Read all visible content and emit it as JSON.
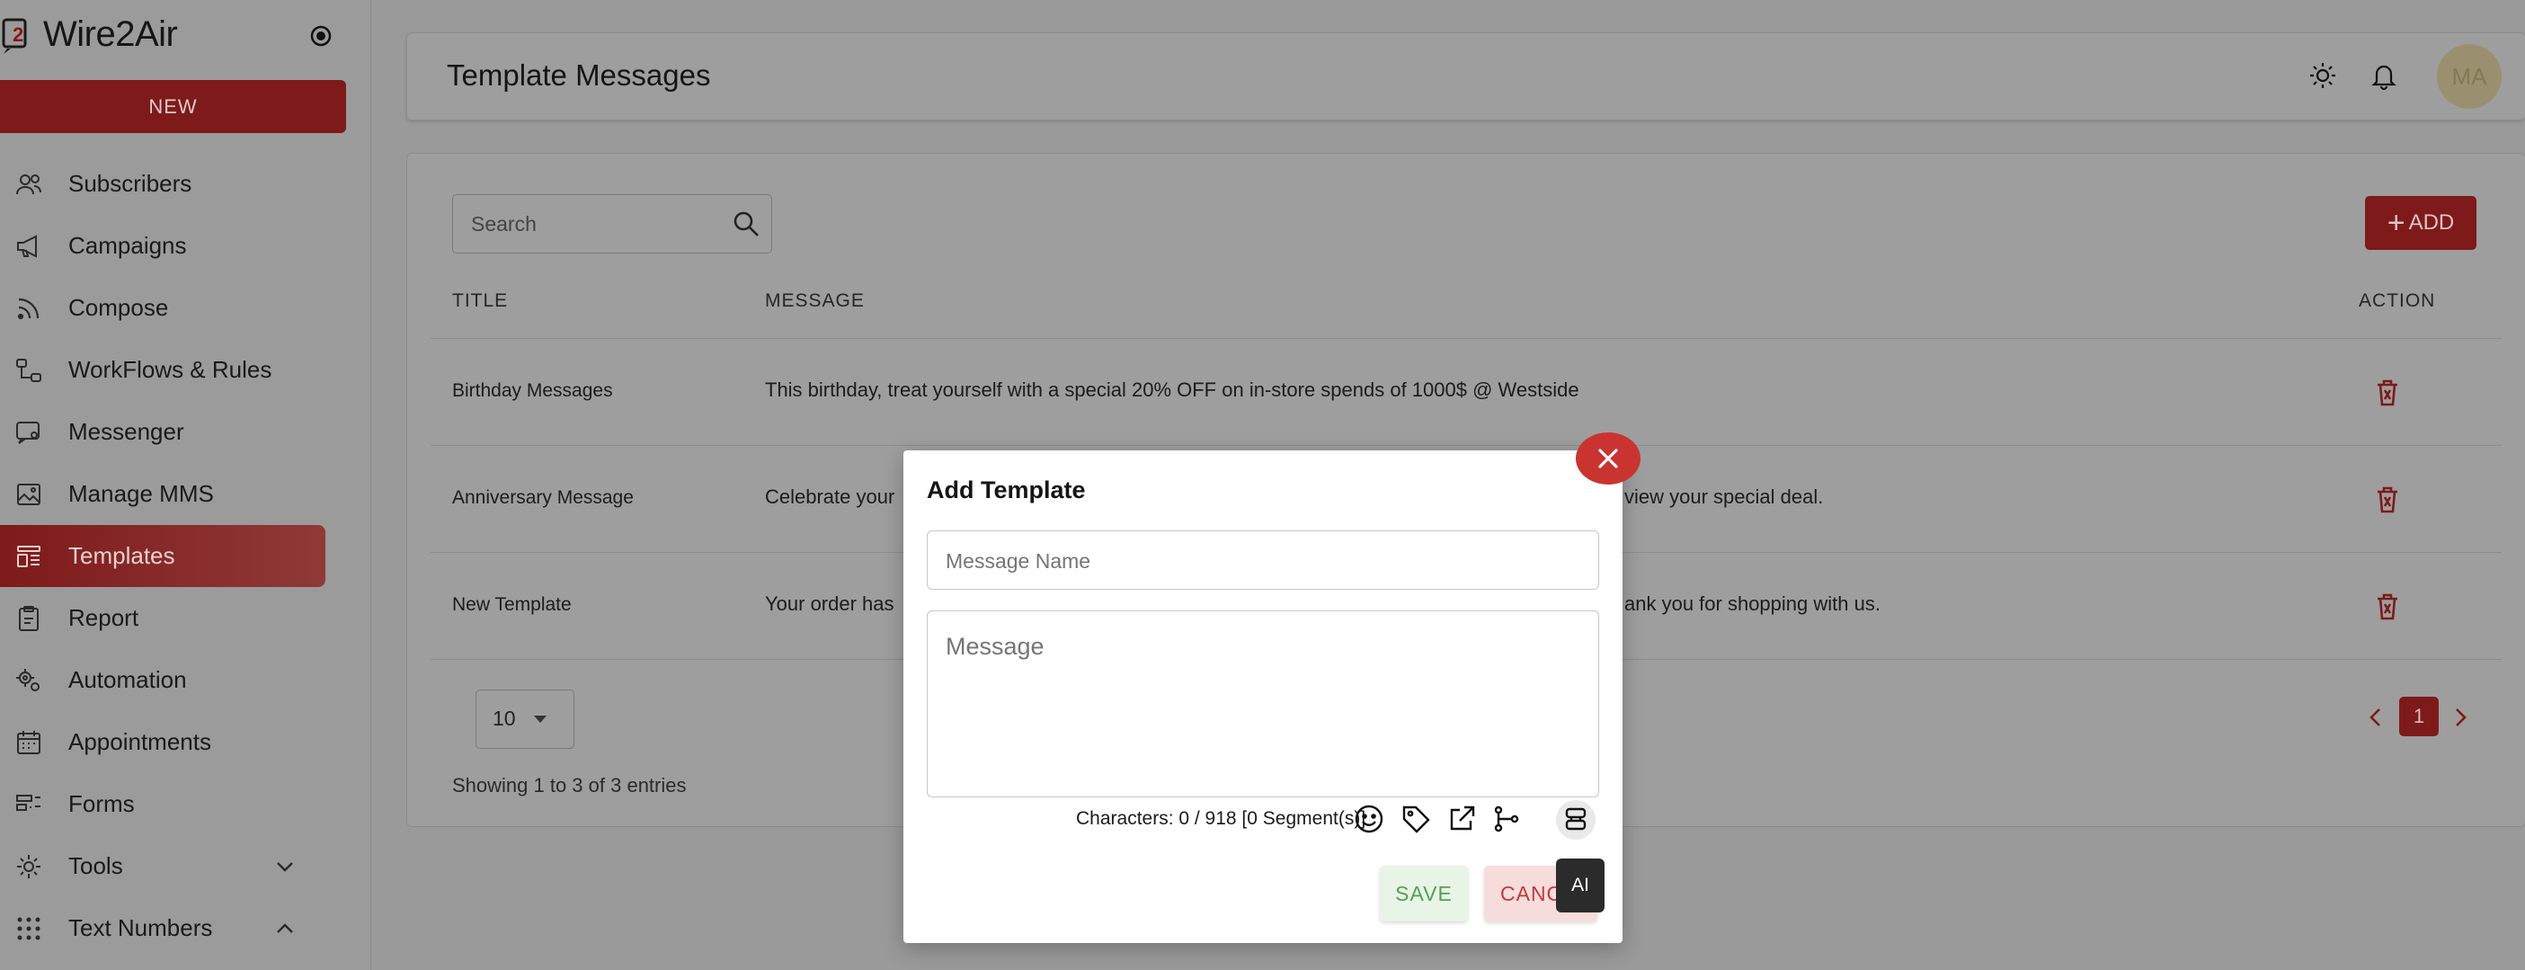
{
  "app": {
    "name": "Wire2Air"
  },
  "sidebar": {
    "new_label": "NEW",
    "items": [
      {
        "label": "Subscribers",
        "icon": "users-icon"
      },
      {
        "label": "Campaigns",
        "icon": "megaphone-icon"
      },
      {
        "label": "Compose",
        "icon": "rss-icon"
      },
      {
        "label": "WorkFlows & Rules",
        "icon": "workflow-icon"
      },
      {
        "label": "Messenger",
        "icon": "chat-user-icon"
      },
      {
        "label": "Manage MMS",
        "icon": "image-icon"
      },
      {
        "label": "Templates",
        "icon": "template-icon",
        "active": true
      },
      {
        "label": "Report",
        "icon": "clipboard-icon"
      },
      {
        "label": "Automation",
        "icon": "gears-icon"
      },
      {
        "label": "Appointments",
        "icon": "calendar-icon"
      },
      {
        "label": "Forms",
        "icon": "form-icon"
      },
      {
        "label": "Tools",
        "icon": "gear-icon",
        "chevron": "down"
      },
      {
        "label": "Text Numbers",
        "icon": "dialpad-icon",
        "chevron": "up"
      }
    ]
  },
  "header": {
    "title": "Template Messages",
    "avatar_initials": "MA"
  },
  "toolbar": {
    "search_placeholder": "Search",
    "add_label": "ADD"
  },
  "table": {
    "columns": {
      "title": "TITLE",
      "message": "MESSAGE",
      "action": "ACTION"
    },
    "rows": [
      {
        "title": "Birthday Messages",
        "message": "This birthday, treat yourself with a special 20% OFF on in-store spends of 1000$ @ Westside"
      },
      {
        "title": "Anniversary Message",
        "message_left": "Celebrate your",
        "message_right": "view your special deal."
      },
      {
        "title": "New Template",
        "message_left": "Your order has",
        "message_right": "ank you for shopping with us."
      }
    ]
  },
  "pagination": {
    "page_size": "10",
    "showing": "Showing 1 to 3 of 3 entries",
    "current_page": "1"
  },
  "modal": {
    "title": "Add Template",
    "name_placeholder": "Message Name",
    "message_placeholder": "Message",
    "char_count": "Characters: 0 / 918 [0 Segment(s)]",
    "save_label": "SAVE",
    "cancel_label": "CANCEL",
    "tooltip": "AI"
  },
  "colors": {
    "brand": "#b22222",
    "close": "#c93431",
    "save_text": "#52a152",
    "cancel_text": "#c03a3a"
  }
}
